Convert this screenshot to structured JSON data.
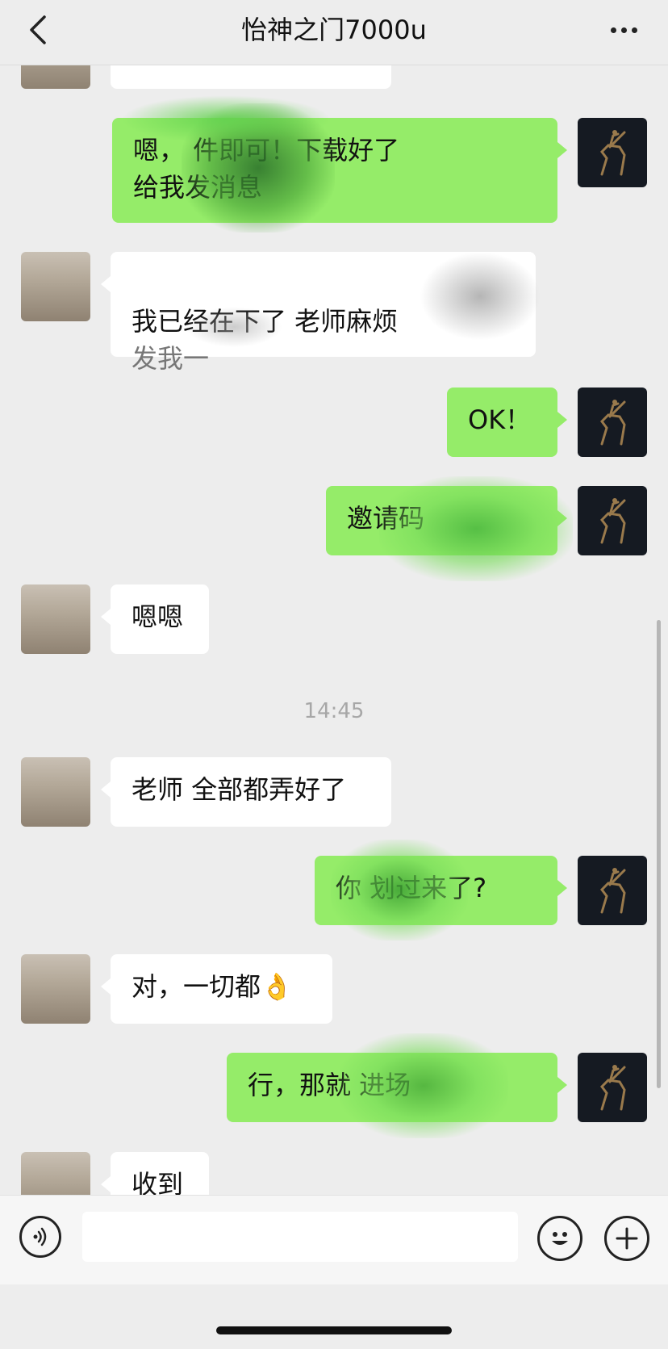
{
  "header": {
    "title": "怡神之门7000u"
  },
  "messages": [
    {
      "side": "in",
      "text": ""
    },
    {
      "side": "out",
      "text": "嗯，           件即可！下载好了\n给我发消息"
    },
    {
      "side": "in",
      "text": "我已经在下了 老师麻烦"
    },
    {
      "side": "in",
      "text": "发我一"
    },
    {
      "side": "out",
      "text": "OK！"
    },
    {
      "side": "out",
      "text": "邀请码"
    },
    {
      "side": "in",
      "text": "嗯嗯"
    },
    {
      "side": "in",
      "text": "老师 全部都弄好了"
    },
    {
      "side": "out",
      "text": "你     划过来了?"
    },
    {
      "side": "in",
      "text": "对，一切都👌"
    },
    {
      "side": "out",
      "text": "行，那就          进场"
    },
    {
      "side": "in",
      "text": "收到"
    }
  ],
  "timestamp": "14:45",
  "colors": {
    "background": "#ededed",
    "outgoing_bubble": "#95ec69",
    "incoming_bubble": "#ffffff"
  },
  "icons": {
    "back": "chevron-left-icon",
    "more": "more-dots-icon",
    "voice": "voice-icon",
    "emoji": "emoji-icon",
    "add": "plus-icon"
  }
}
